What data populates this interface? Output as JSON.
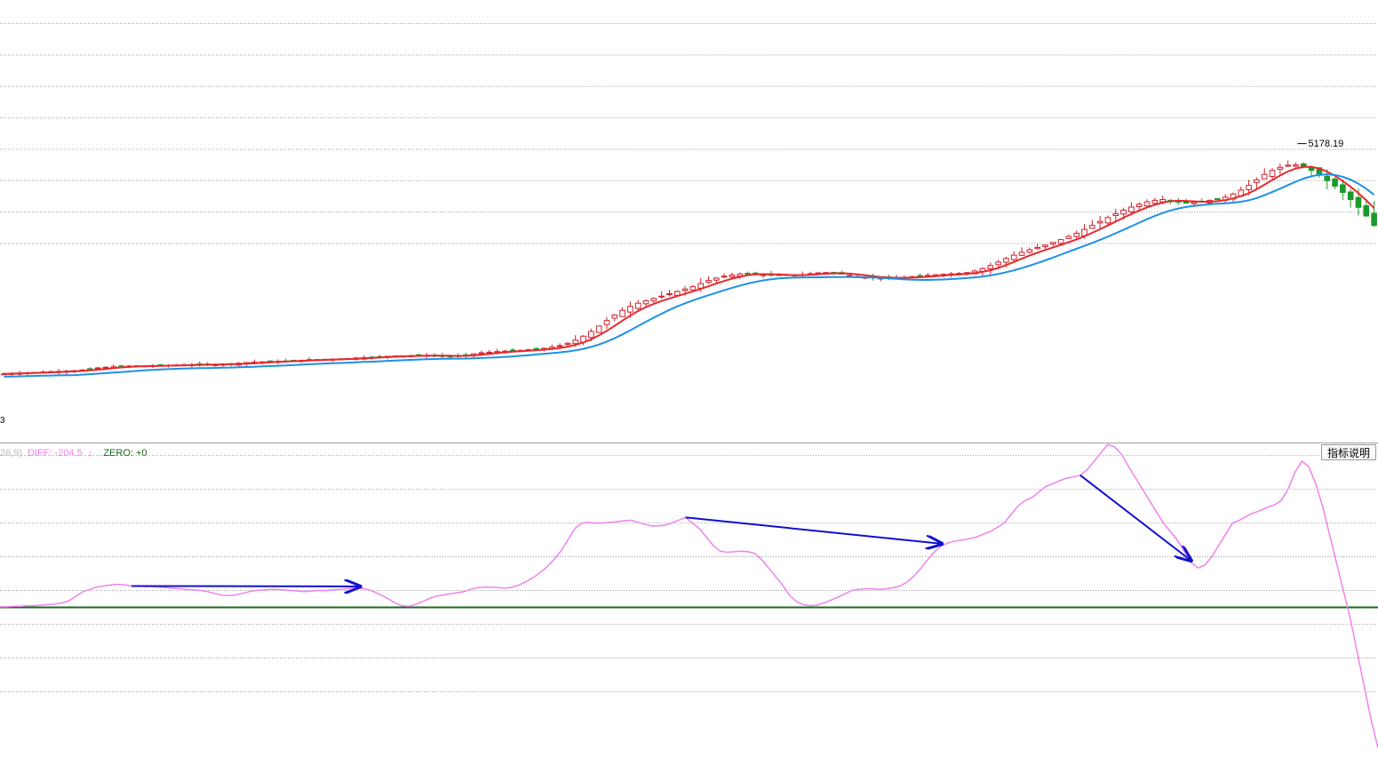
{
  "chart_data": [
    {
      "type": "candlestick",
      "title": "",
      "price_max_label": "5178.19",
      "price_min_label": "3",
      "ylim": [
        2400,
        5200
      ],
      "colors": {
        "up": "#d0202a",
        "down": "#1a9a2a",
        "ma_fast": "#e8292e",
        "ma_slow": "#1e90e6",
        "grid": "#9a9a9a"
      },
      "gridlines_price": [
        5050,
        4850,
        4650,
        4450,
        4250,
        4050,
        3850,
        3650
      ],
      "close_series": [
        2820,
        2823,
        2825,
        2828,
        2830,
        2832,
        2834,
        2836,
        2838,
        2840,
        2845,
        2852,
        2858,
        2862,
        2865,
        2868,
        2870,
        2871,
        2870,
        2872,
        2874,
        2875,
        2876,
        2877,
        2878,
        2880,
        2879,
        2881,
        2882,
        2884,
        2888,
        2892,
        2895,
        2897,
        2898,
        2900,
        2902,
        2905,
        2907,
        2909,
        2911,
        2913,
        2914,
        2916,
        2918,
        2921,
        2924,
        2927,
        2930,
        2932,
        2934,
        2935,
        2936,
        2937,
        2938,
        2937,
        2934,
        2932,
        2933,
        2940,
        2948,
        2954,
        2958,
        2962,
        2965,
        2967,
        2970,
        2974,
        2978,
        2983,
        2990,
        3000,
        3015,
        3035,
        3060,
        3090,
        3125,
        3160,
        3195,
        3225,
        3250,
        3270,
        3285,
        3300,
        3315,
        3330,
        3345,
        3360,
        3375,
        3395,
        3415,
        3430,
        3442,
        3450,
        3456,
        3460,
        3457,
        3452,
        3448,
        3446,
        3448,
        3450,
        3452,
        3458,
        3463,
        3465,
        3462,
        3455,
        3447,
        3440,
        3435,
        3432,
        3430,
        3430,
        3432,
        3435,
        3438,
        3442,
        3447,
        3451,
        3454,
        3457,
        3460,
        3465,
        3475,
        3490,
        3510,
        3532,
        3555,
        3576,
        3594,
        3610,
        3625,
        3640,
        3657,
        3675,
        3695,
        3715,
        3740,
        3765,
        3790,
        3815,
        3840,
        3862,
        3882,
        3900,
        3915,
        3925,
        3930,
        3925,
        3915,
        3910,
        3912,
        3918,
        3925,
        3932,
        3945,
        3965,
        3990,
        4020,
        4055,
        4090,
        4115,
        4135,
        4148,
        4150,
        4140,
        4115,
        4085,
        4050,
        4015,
        3975,
        3930,
        3880,
        3825,
        3765
      ]
    },
    {
      "type": "line",
      "legend": {
        "prefix": "26,9)",
        "diff_label": "DIFF: -204.5",
        "diff_arrow": "↓",
        "zero_label": "ZERO: +0"
      },
      "colors": {
        "diff": "#ee82ee",
        "zero": "#1a6a1a",
        "arrow": "#1010cc"
      },
      "ylim": [
        -260,
        290
      ],
      "zero": 0,
      "gridlines": [
        270,
        210,
        150,
        90,
        30,
        -30,
        -90,
        -150
      ],
      "x_index": [
        0,
        193
      ],
      "diff_series": [
        1,
        1,
        2,
        2,
        3,
        3,
        4,
        5,
        6,
        8,
        12,
        20,
        28,
        32,
        36,
        38,
        40,
        41,
        40,
        38,
        38,
        37,
        37,
        36,
        35,
        34,
        33,
        32,
        31,
        30,
        28,
        25,
        22,
        21,
        22,
        25,
        28,
        30,
        31,
        32,
        32,
        31,
        30,
        29,
        28,
        29,
        30,
        30,
        31,
        32,
        33,
        34,
        34,
        32,
        28,
        22,
        16,
        8,
        3,
        2,
        5,
        10,
        16,
        20,
        22,
        24,
        26,
        28,
        32,
        35,
        36,
        36,
        35,
        34,
        36,
        40,
        46,
        53,
        62,
        72,
        85,
        100,
        120,
        140,
        150,
        151,
        150,
        150,
        151,
        152,
        154,
        155,
        152,
        148,
        145,
        145,
        146,
        150,
        155,
        160,
        150,
        140,
        125,
        110,
        100,
        98,
        99,
        100,
        99,
        96,
        85,
        70,
        55,
        40,
        22,
        10,
        5,
        3,
        4,
        8,
        13,
        18,
        24,
        30,
        32,
        33,
        33,
        32,
        33,
        35,
        38,
        45,
        56,
        70,
        85,
        100,
        110,
        115,
        118,
        120,
        122,
        125,
        130,
        135,
        142,
        150,
        165,
        180,
        190,
        195,
        205,
        215,
        220,
        225,
        230,
        232,
        235,
        245,
        260,
        275,
        290,
        285,
        272,
        250,
        230,
        210,
        190,
        170,
        150,
        135,
        120,
        100,
        80,
        70,
        75,
        90,
        110,
        130,
        150,
        155,
        162,
        168,
        172,
        178,
        182,
        190,
        210,
        240,
        260,
        250,
        220,
        180,
        130,
        80,
        30,
        -20,
        -80,
        -140,
        -200,
        -250
      ]
    }
  ],
  "ui": {
    "help_button_label": "指标说明"
  }
}
